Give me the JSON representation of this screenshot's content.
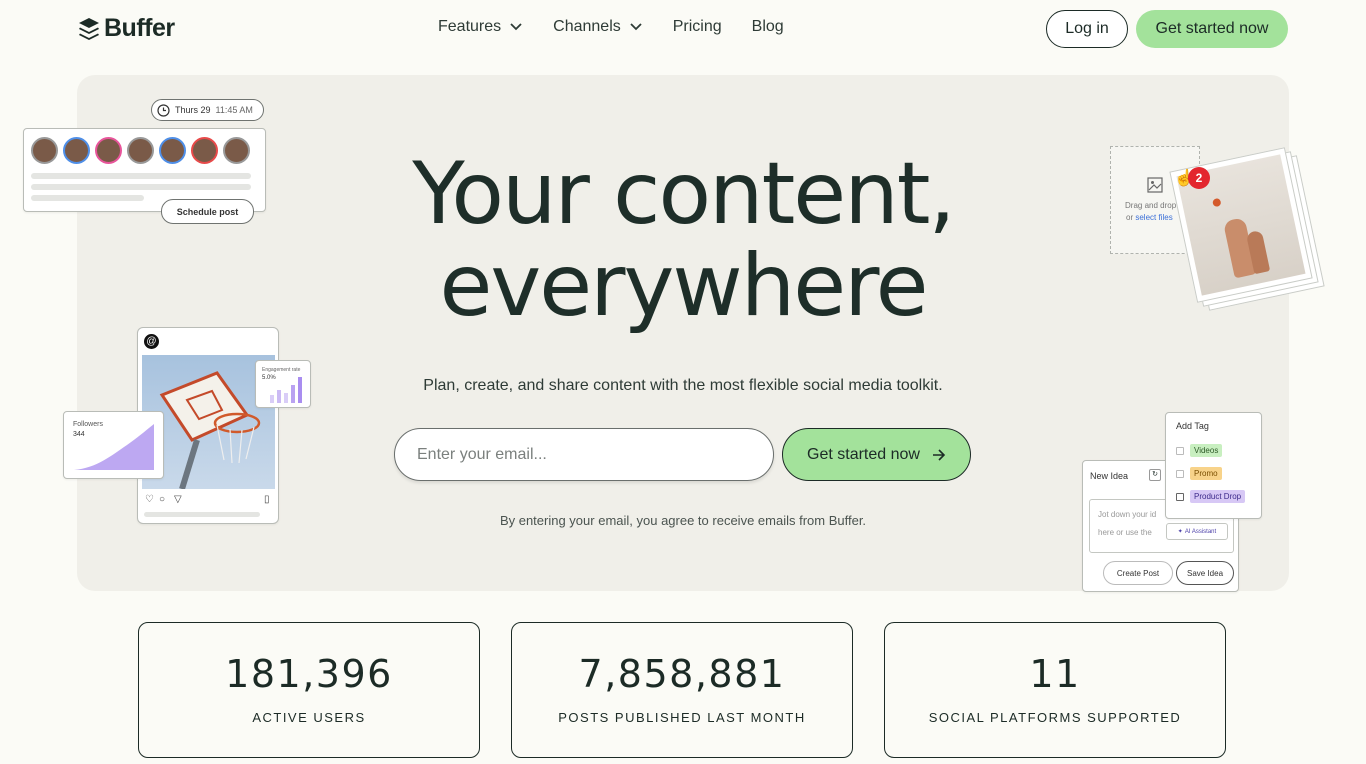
{
  "nav": {
    "brand": "Buffer",
    "links": [
      {
        "label": "Features",
        "has_dropdown": true
      },
      {
        "label": "Channels",
        "has_dropdown": true
      },
      {
        "label": "Pricing",
        "has_dropdown": false
      },
      {
        "label": "Blog",
        "has_dropdown": false
      }
    ],
    "login_label": "Log in",
    "cta_label": "Get started now"
  },
  "hero": {
    "title_line1": "Your content,",
    "title_line2": "everywhere",
    "subtitle": "Plan, create, and share content with the most flexible social media toolkit.",
    "email_placeholder": "Enter your email...",
    "cta_label": "Get started now",
    "consent": "By entering your email, you agree to receive emails from Buffer."
  },
  "decor": {
    "schedule": {
      "date": "Thurs 29",
      "time": "11:45 AM",
      "button": "Schedule post"
    },
    "followers": {
      "label": "Followers",
      "value": "344"
    },
    "engagement": {
      "label": "Engagement rate",
      "value": "5.0%"
    },
    "upload": {
      "line1": "Drag and drop",
      "line2_prefix": "or ",
      "link": "select files",
      "badge": "2"
    },
    "tags": {
      "title": "Add Tag",
      "items": [
        {
          "label": "Videos",
          "color": "#c8efc0"
        },
        {
          "label": "Promo",
          "color": "#f8d38a"
        },
        {
          "label": "Product Drop",
          "color": "#d7c8f5"
        }
      ]
    },
    "idea": {
      "title": "New Idea",
      "placeholder_1": "Jot down your id",
      "placeholder_2": "here or use the",
      "ai_label": "AI Assistant",
      "create_label": "Create Post",
      "save_label": "Save Idea"
    }
  },
  "stats": [
    {
      "value": "181,396",
      "label": "ACTIVE USERS"
    },
    {
      "value": "7,858,881",
      "label": "POSTS PUBLISHED LAST MONTH"
    },
    {
      "value": "11",
      "label": "SOCIAL PLATFORMS SUPPORTED"
    }
  ],
  "colors": {
    "accent": "#a3e29b",
    "text": "#1c2b26",
    "hero_bg": "#f0efe9",
    "page_bg": "#fbfbf6"
  }
}
